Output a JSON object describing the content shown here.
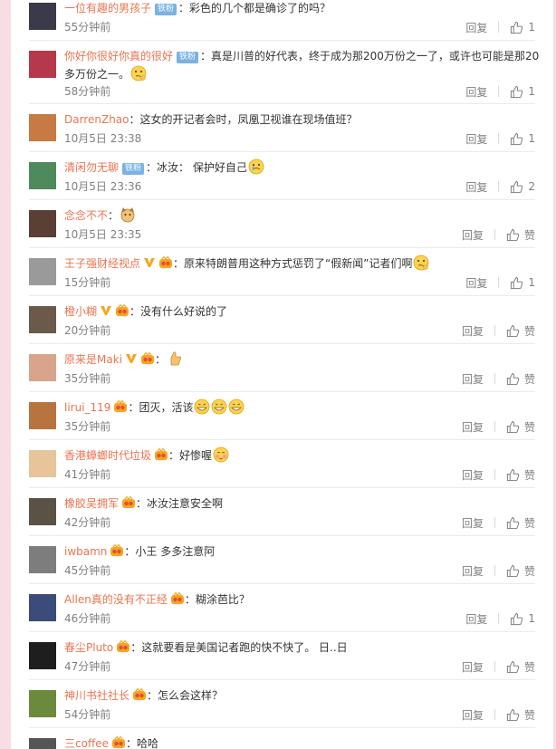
{
  "comments": [
    {
      "name": "一位有趣的男孩子",
      "badge": "铁粉",
      "text": "：彩色的几个都是确诊了的吗？",
      "time": "55分钟前",
      "reply": "回复",
      "like": "1",
      "avatar": "#3a3a4a",
      "emoji": []
    },
    {
      "name": "你好你很好你真的很好",
      "badge": "铁粉",
      "text": "：真是川普的好代表，终于成为那200万份之一了，或许也可能是那20多万份之一。",
      "time": "58分钟前",
      "reply": "回复",
      "like": "1",
      "avatar": "#b5394b",
      "emoji": [
        "think"
      ],
      "multi": true
    },
    {
      "name": "DarrenZhao",
      "text": "：这女的开记者会时，凤凰卫视谁在现场值班？",
      "time": "10月5日 23:38",
      "reply": "回复",
      "like": "1",
      "avatar": "#c77a43",
      "emoji": []
    },
    {
      "name": "清闲勿无聊",
      "badge": "铁粉",
      "text": "：冰汝： 保护好自己",
      "time": "10月5日 23:36",
      "reply": "回复",
      "like": "2",
      "avatar": "#4e8a5c",
      "emoji": [
        "cry"
      ]
    },
    {
      "name": "念念不不",
      "text": "：",
      "time": "10月5日 23:35",
      "reply": "回复",
      "like": "赞",
      "avatar": "#5a3f34",
      "emoji": [
        "dog"
      ]
    },
    {
      "name": "王子强财经视点",
      "vip": true,
      "gold": true,
      "text": "：原来特朗普用这种方式惩罚了“假新闻”记者们啊",
      "time": "15分钟前",
      "reply": "回复",
      "like": "1",
      "avatar": "#9a9a9a",
      "emoji": [
        "think"
      ]
    },
    {
      "name": "橙小糊",
      "vip": true,
      "gold": true,
      "text": "：没有什么好说的了",
      "time": "20分钟前",
      "reply": "回复",
      "like": "赞",
      "avatar": "#6b5a4a",
      "emoji": []
    },
    {
      "name": "原来是Maki",
      "vip": true,
      "gold": true,
      "text": "：",
      "time": "35分钟前",
      "reply": "回复",
      "like": "赞",
      "avatar": "#d9a58a",
      "emoji": [
        "thumb"
      ]
    },
    {
      "name": "lirui_119",
      "gold": true,
      "text": "：团灭，活该",
      "time": "35分钟前",
      "reply": "回复",
      "like": "赞",
      "avatar": "#b8743e",
      "emoji": [
        "grin",
        "grin",
        "grin"
      ]
    },
    {
      "name": "香港蟑螂时代垃圾",
      "gold": true,
      "text": "：好惨喔",
      "time": "41分钟前",
      "reply": "回复",
      "like": "赞",
      "avatar": "#e8c49a",
      "emoji": [
        "shy"
      ]
    },
    {
      "name": "橡胶吴拥军",
      "gold": true,
      "text": "：冰汝注意安全啊",
      "time": "42分钟前",
      "reply": "回复",
      "like": "赞",
      "avatar": "#5b5246",
      "emoji": []
    },
    {
      "name": "iwbamn",
      "gold": true,
      "text": "：小王 多多注意阿",
      "time": "45分钟前",
      "reply": "回复",
      "like": "赞",
      "avatar": "#7d7d7d",
      "emoji": []
    },
    {
      "name": "Allen真的没有不正经",
      "gold": true,
      "text": "：糊涂芭比？",
      "time": "46分钟前",
      "reply": "回复",
      "like": "1",
      "avatar": "#3b4b7a",
      "emoji": []
    },
    {
      "name": "春尘Pluto",
      "gold": true,
      "text": "：这就要看是美国记者跑的快不快了。 日..日",
      "time": "47分钟前",
      "reply": "回复",
      "like": "赞",
      "avatar": "#1e1e1e",
      "emoji": []
    },
    {
      "name": "神川书社社长",
      "gold": true,
      "text": "：怎么会这样？",
      "time": "54分钟前",
      "reply": "回复",
      "like": "赞",
      "avatar": "#6c8a3c",
      "emoji": []
    },
    {
      "name": "三coffee",
      "gold": true,
      "text": "：哈哈",
      "time": "",
      "reply": "",
      "like": "",
      "avatar": "#555555",
      "emoji": []
    }
  ],
  "colors": {
    "name": "#eb7350",
    "time": "#808080",
    "accent_vip": "#f5a623",
    "badge": "#7ab2e4"
  }
}
